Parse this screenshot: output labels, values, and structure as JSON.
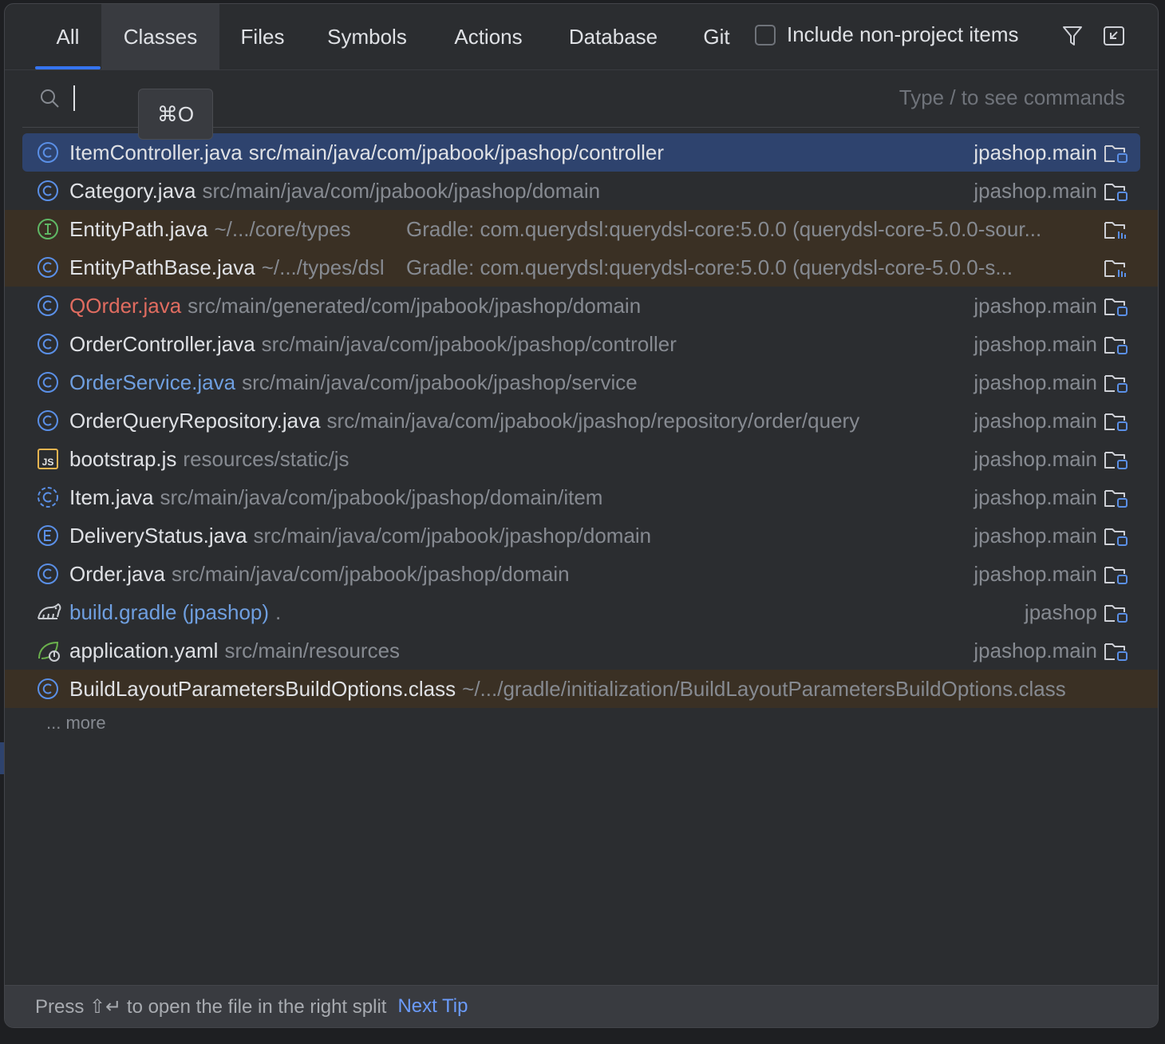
{
  "tabs": [
    {
      "label": "All"
    },
    {
      "label": "Classes"
    },
    {
      "label": "Files"
    },
    {
      "label": "Symbols"
    },
    {
      "label": "Actions"
    },
    {
      "label": "Database"
    },
    {
      "label": "Git"
    }
  ],
  "include_non_project": {
    "label": "Include non-project items",
    "checked": false
  },
  "search": {
    "value": "",
    "hint": "Type / to see commands"
  },
  "tooltip": {
    "shortcut": "⌘O"
  },
  "results": [
    {
      "icon": "class-icon",
      "name": "ItemController.java",
      "path": "src/main/java/com/jpabook/jpashop/controller",
      "location": "jpashop.main"
    },
    {
      "icon": "class-icon",
      "name": "Category.java",
      "path": "src/main/java/com/jpabook/jpashop/domain",
      "location": "jpashop.main"
    },
    {
      "icon": "interface-icon",
      "name": "EntityPath.java",
      "path": "~/.../core/types",
      "location": "Gradle: com.querydsl:querydsl-core:5.0.0 (querydsl-core-5.0.0-sour..."
    },
    {
      "icon": "class-icon",
      "name": "EntityPathBase.java",
      "path": "~/.../types/dsl",
      "location": "Gradle: com.querydsl:querydsl-core:5.0.0 (querydsl-core-5.0.0-s..."
    },
    {
      "icon": "class-icon",
      "name": "QOrder.java",
      "path": "src/main/generated/com/jpabook/jpashop/domain",
      "location": "jpashop.main"
    },
    {
      "icon": "class-icon",
      "name": "OrderController.java",
      "path": "src/main/java/com/jpabook/jpashop/controller",
      "location": "jpashop.main"
    },
    {
      "icon": "class-icon",
      "name": "OrderService.java",
      "path": "src/main/java/com/jpabook/jpashop/service",
      "location": "jpashop.main"
    },
    {
      "icon": "class-icon",
      "name": "OrderQueryRepository.java",
      "path": "src/main/java/com/jpabook/jpashop/repository/order/query",
      "location": "jpashop.main"
    },
    {
      "icon": "javascript-file-icon",
      "name": "bootstrap.js",
      "path": "resources/static/js",
      "location": "jpashop.main"
    },
    {
      "icon": "abstract-class-icon",
      "name": "Item.java",
      "path": "src/main/java/com/jpabook/jpashop/domain/item",
      "location": "jpashop.main"
    },
    {
      "icon": "enum-icon",
      "name": "DeliveryStatus.java",
      "path": "src/main/java/com/jpabook/jpashop/domain",
      "location": "jpashop.main"
    },
    {
      "icon": "class-icon",
      "name": "Order.java",
      "path": "src/main/java/com/jpabook/jpashop/domain",
      "location": "jpashop.main"
    },
    {
      "icon": "gradle-icon",
      "name": "build.gradle (jpashop)",
      "path": ".",
      "location": "jpashop"
    },
    {
      "icon": "spring-config-icon",
      "name": "application.yaml",
      "path": "src/main/resources",
      "location": "jpashop.main"
    },
    {
      "icon": "class-icon",
      "name": "BuildLayoutParametersBuildOptions.class",
      "path": "~/.../gradle/initialization/BuildLayoutParametersBuildOptions.class",
      "location": ""
    }
  ],
  "more_label": "... more",
  "footer": {
    "tip": "Press ⇧↵ to open the file in the right split",
    "next_tip": "Next Tip"
  },
  "colors": {
    "accent": "#3574f0",
    "selection": "#2e436e",
    "non_project_row": "#3a3024",
    "modified_file": "#e06c60",
    "vcs_changed_file": "#6f9fe0"
  }
}
